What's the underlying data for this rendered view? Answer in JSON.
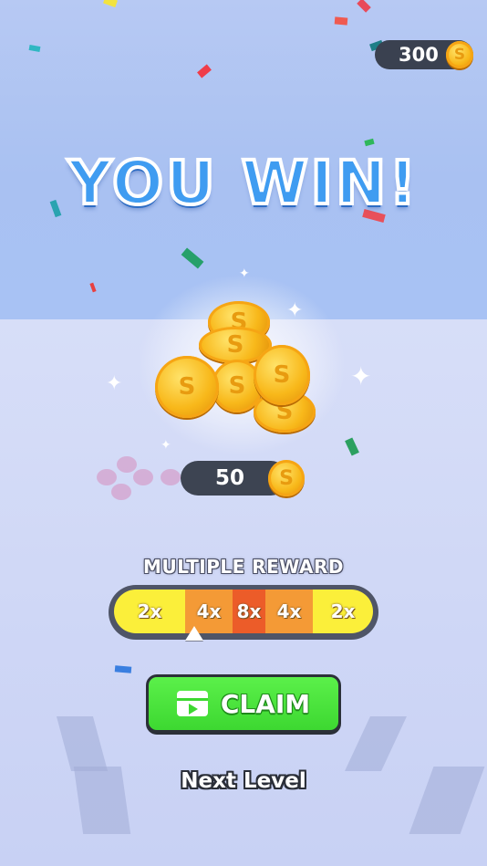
{
  "title": "YOU WIN!",
  "currency": {
    "amount": "300",
    "icon": "coin-icon",
    "coin_symbol": "S"
  },
  "reward": {
    "amount": "50",
    "icon": "coin-icon",
    "coin_symbol": "S"
  },
  "multiplier": {
    "label": "MULTIPLE REWARD",
    "segments": [
      "2x",
      "4x",
      "8x",
      "4x",
      "2x"
    ],
    "selected_index": 1
  },
  "claim_button": {
    "label": "CLAIM",
    "icon": "video-icon"
  },
  "next_level": {
    "label": "Next Level"
  },
  "colors": {
    "title_blue": "#3f9cf1",
    "claim_green": "#3dd831",
    "segment_yellow": "#fbef3a",
    "segment_orange": "#f49a36",
    "segment_red": "#ec5c29",
    "pill_dark": "#3a4150"
  }
}
